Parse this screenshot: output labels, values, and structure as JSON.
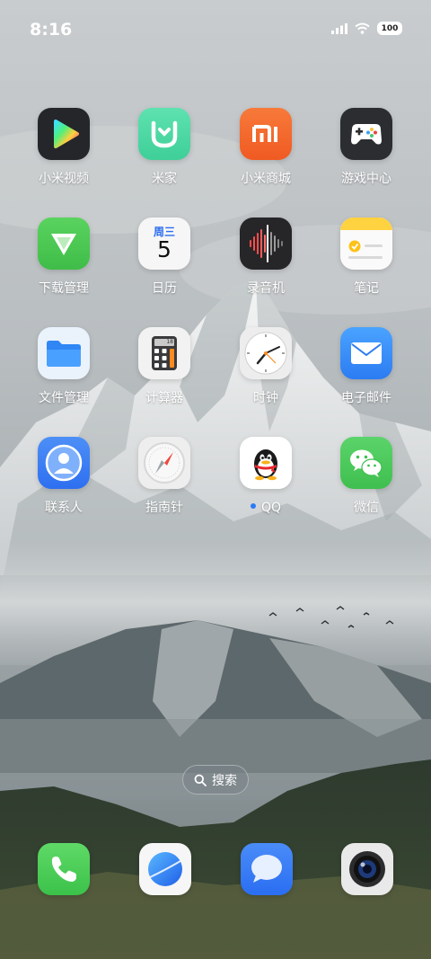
{
  "status_bar": {
    "time": "8:16",
    "battery": "100"
  },
  "apps": [
    {
      "label": "小米视频",
      "icon": "mi-video-icon"
    },
    {
      "label": "米家",
      "icon": "mijia-icon"
    },
    {
      "label": "小米商城",
      "icon": "mi-store-icon"
    },
    {
      "label": "游戏中心",
      "icon": "game-center-icon"
    },
    {
      "label": "下载管理",
      "icon": "downloads-icon"
    },
    {
      "label": "日历",
      "icon": "calendar-icon",
      "weekday": "周三",
      "day": "5"
    },
    {
      "label": "录音机",
      "icon": "recorder-icon"
    },
    {
      "label": "笔记",
      "icon": "notes-icon"
    },
    {
      "label": "文件管理",
      "icon": "file-manager-icon"
    },
    {
      "label": "计算器",
      "icon": "calculator-icon",
      "display": "18"
    },
    {
      "label": "时钟",
      "icon": "clock-icon"
    },
    {
      "label": "电子邮件",
      "icon": "email-icon"
    },
    {
      "label": "联系人",
      "icon": "contacts-icon"
    },
    {
      "label": "指南针",
      "icon": "compass-icon"
    },
    {
      "label": "QQ",
      "icon": "qq-icon",
      "new_badge": true
    },
    {
      "label": "微信",
      "icon": "wechat-icon"
    }
  ],
  "search": {
    "label": "搜索"
  },
  "dock": [
    {
      "icon": "phone-icon"
    },
    {
      "icon": "browser-icon"
    },
    {
      "icon": "messages-icon"
    },
    {
      "icon": "camera-icon"
    }
  ]
}
